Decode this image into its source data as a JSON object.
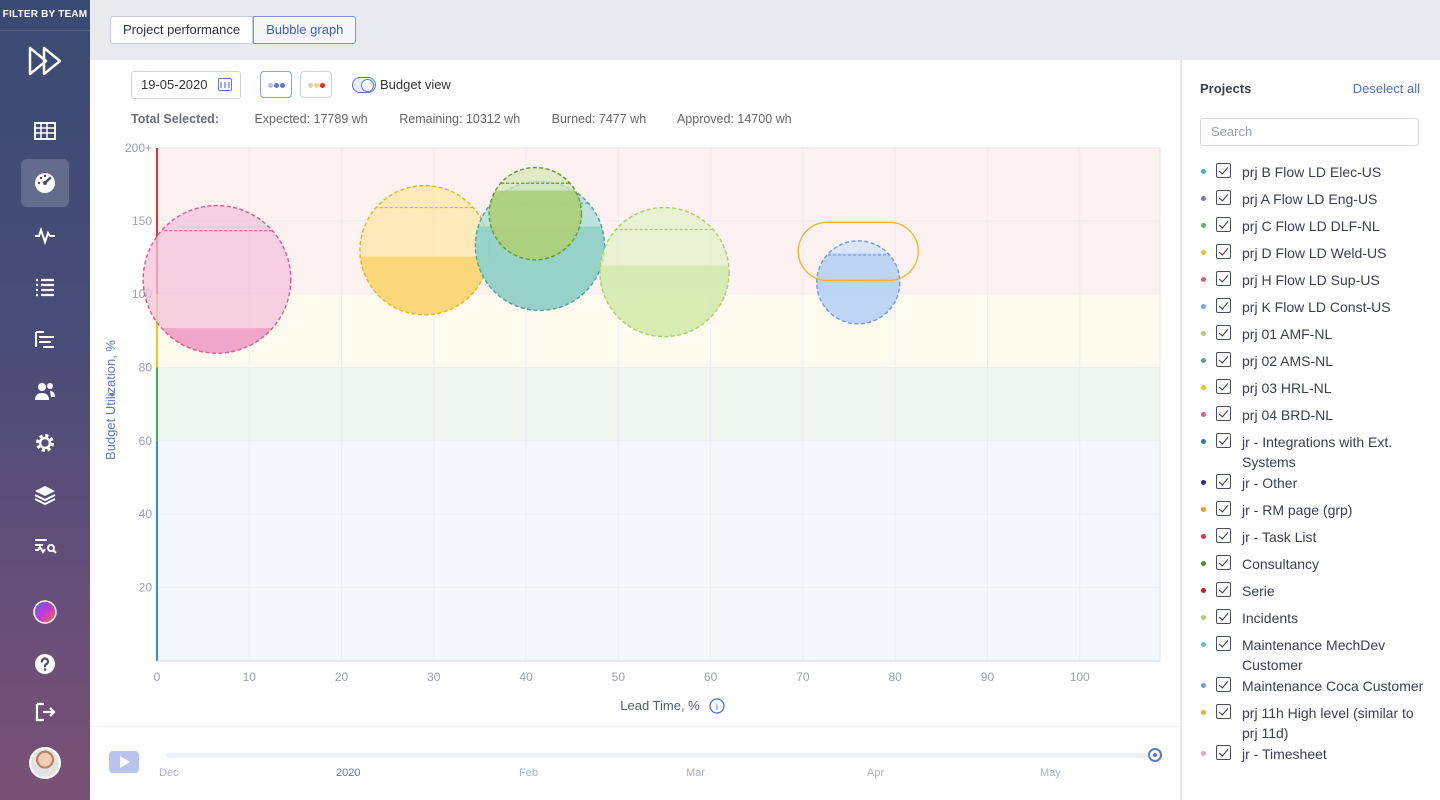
{
  "sidebar": {
    "filter_label": "FILTER BY TEAM",
    "icons": [
      "logo-icon",
      "table-icon",
      "dashboard-icon",
      "activity-icon",
      "list-icon",
      "tasks-icon",
      "users-icon",
      "settings-icon",
      "layers-icon",
      "search-analytics-icon",
      "color-wheel-icon",
      "help-icon",
      "logout-icon",
      "avatar"
    ]
  },
  "tabs": [
    {
      "label": "Project performance",
      "active": false
    },
    {
      "label": "Bubble graph",
      "active": true
    }
  ],
  "toolbar": {
    "date": "19-05-2020",
    "budget_view_label": "Budget view"
  },
  "totals": {
    "label": "Total Selected:",
    "expected": "Expected: 17789 wh",
    "remaining": "Remaining: 10312 wh",
    "burned": "Burned: 7477 wh",
    "approved": "Approved: 14700 wh"
  },
  "chart_data": {
    "type": "scatter",
    "xlabel": "Lead Time, %",
    "ylabel": "Budget Utilization, %",
    "x_ticks": [
      "0",
      "10",
      "20",
      "30",
      "40",
      "50",
      "60",
      "70",
      "80",
      "90",
      "100"
    ],
    "y_ticks": [
      "20",
      "40",
      "60",
      "80",
      "100",
      "150",
      "200+"
    ],
    "zones": [
      {
        "name": "over",
        "from": 100,
        "to": 200,
        "color": "#fdf1f1"
      },
      {
        "name": "warning",
        "from": 80,
        "to": 100,
        "color": "#fefaee"
      },
      {
        "name": "good",
        "from": 60,
        "to": 80,
        "color": "#eef8ef"
      },
      {
        "name": "under",
        "from": 0,
        "to": 60,
        "color": "#f4f8fd"
      }
    ],
    "bubbles": [
      {
        "x": 6.5,
        "y": 110,
        "r": 8,
        "fill": "#f3c3d9",
        "burned": "#ee9fc4",
        "burn_frac": 0.17,
        "stroke": "#d95b8f"
      },
      {
        "x": 29,
        "y": 130,
        "r": 7,
        "fill": "#fde6a8",
        "burned": "#fbd36e",
        "burn_frac": 0.45,
        "stroke": "#e7b51b"
      },
      {
        "x": 41.5,
        "y": 133,
        "r": 7,
        "fill": "#a7dcd6",
        "burned": "#8fcfc7",
        "burn_frac": 0.65,
        "stroke": "#4aa39a"
      },
      {
        "x": 41,
        "y": 155,
        "r": 5,
        "fill": "#d5e8b5",
        "burned": "#a8cc76",
        "burn_frac": 0.75,
        "stroke": "#5b9a27"
      },
      {
        "x": 55,
        "y": 115,
        "r": 7,
        "fill": "#e2f0c7",
        "burned": "#d3e9ae",
        "burn_frac": 0.55,
        "stroke": "#a5cf67"
      },
      {
        "x": 76,
        "y": 108,
        "r": 4.5,
        "fill": "#cfe0f7",
        "burned": "#b8d1f5",
        "burn_frac": 0.85,
        "stroke": "#6e9be4"
      }
    ]
  },
  "timeline": {
    "months": [
      "Dec",
      "2020",
      "Feb",
      "Mar",
      "Apr",
      "May"
    ]
  },
  "projects": {
    "title": "Projects",
    "deselect_label": "Deselect all",
    "search_placeholder": "Search",
    "items": [
      {
        "label": "prj B Flow LD Elec-US",
        "color": "#3bb3c9"
      },
      {
        "label": "prj A Flow LD Eng-US",
        "color": "#6a7fcf"
      },
      {
        "label": "prj C Flow LD DLF-NL",
        "color": "#57b862"
      },
      {
        "label": "prj D Flow LD Weld-US",
        "color": "#f2c01b"
      },
      {
        "label": "prj H Flow LD Sup-US",
        "color": "#e35b6a"
      },
      {
        "label": "prj K Flow LD Const-US",
        "color": "#7aa6ea"
      },
      {
        "label": "prj 01 AMF-NL",
        "color": "#a5d36a"
      },
      {
        "label": "prj 02 AMS-NL",
        "color": "#4aa39a"
      },
      {
        "label": "prj 03 HRL-NL",
        "color": "#f2c01b"
      },
      {
        "label": "prj 04 BRD-NL",
        "color": "#d95b8f"
      },
      {
        "label": "jr - Integrations with Ext. Systems",
        "color": "#2c7ea1"
      },
      {
        "label": "jr - Other",
        "color": "#2b2f8a"
      },
      {
        "label": "jr - RM page (grp)",
        "color": "#f59a23"
      },
      {
        "label": "jr - Task List",
        "color": "#e0304d"
      },
      {
        "label": "Consultancy",
        "color": "#4f8f1f"
      },
      {
        "label": "Serie",
        "color": "#c4161c"
      },
      {
        "label": "Incidents",
        "color": "#a5d36a"
      },
      {
        "label": "Maintenance MechDev Customer",
        "color": "#5bc0de"
      },
      {
        "label": "Maintenance Coca Customer",
        "color": "#6e9be4"
      },
      {
        "label": "prj 11h High level (similar to prj 11d)",
        "color": "#f2b01b"
      },
      {
        "label": "jr - Timesheet",
        "color": "#f2a0b5"
      }
    ]
  }
}
